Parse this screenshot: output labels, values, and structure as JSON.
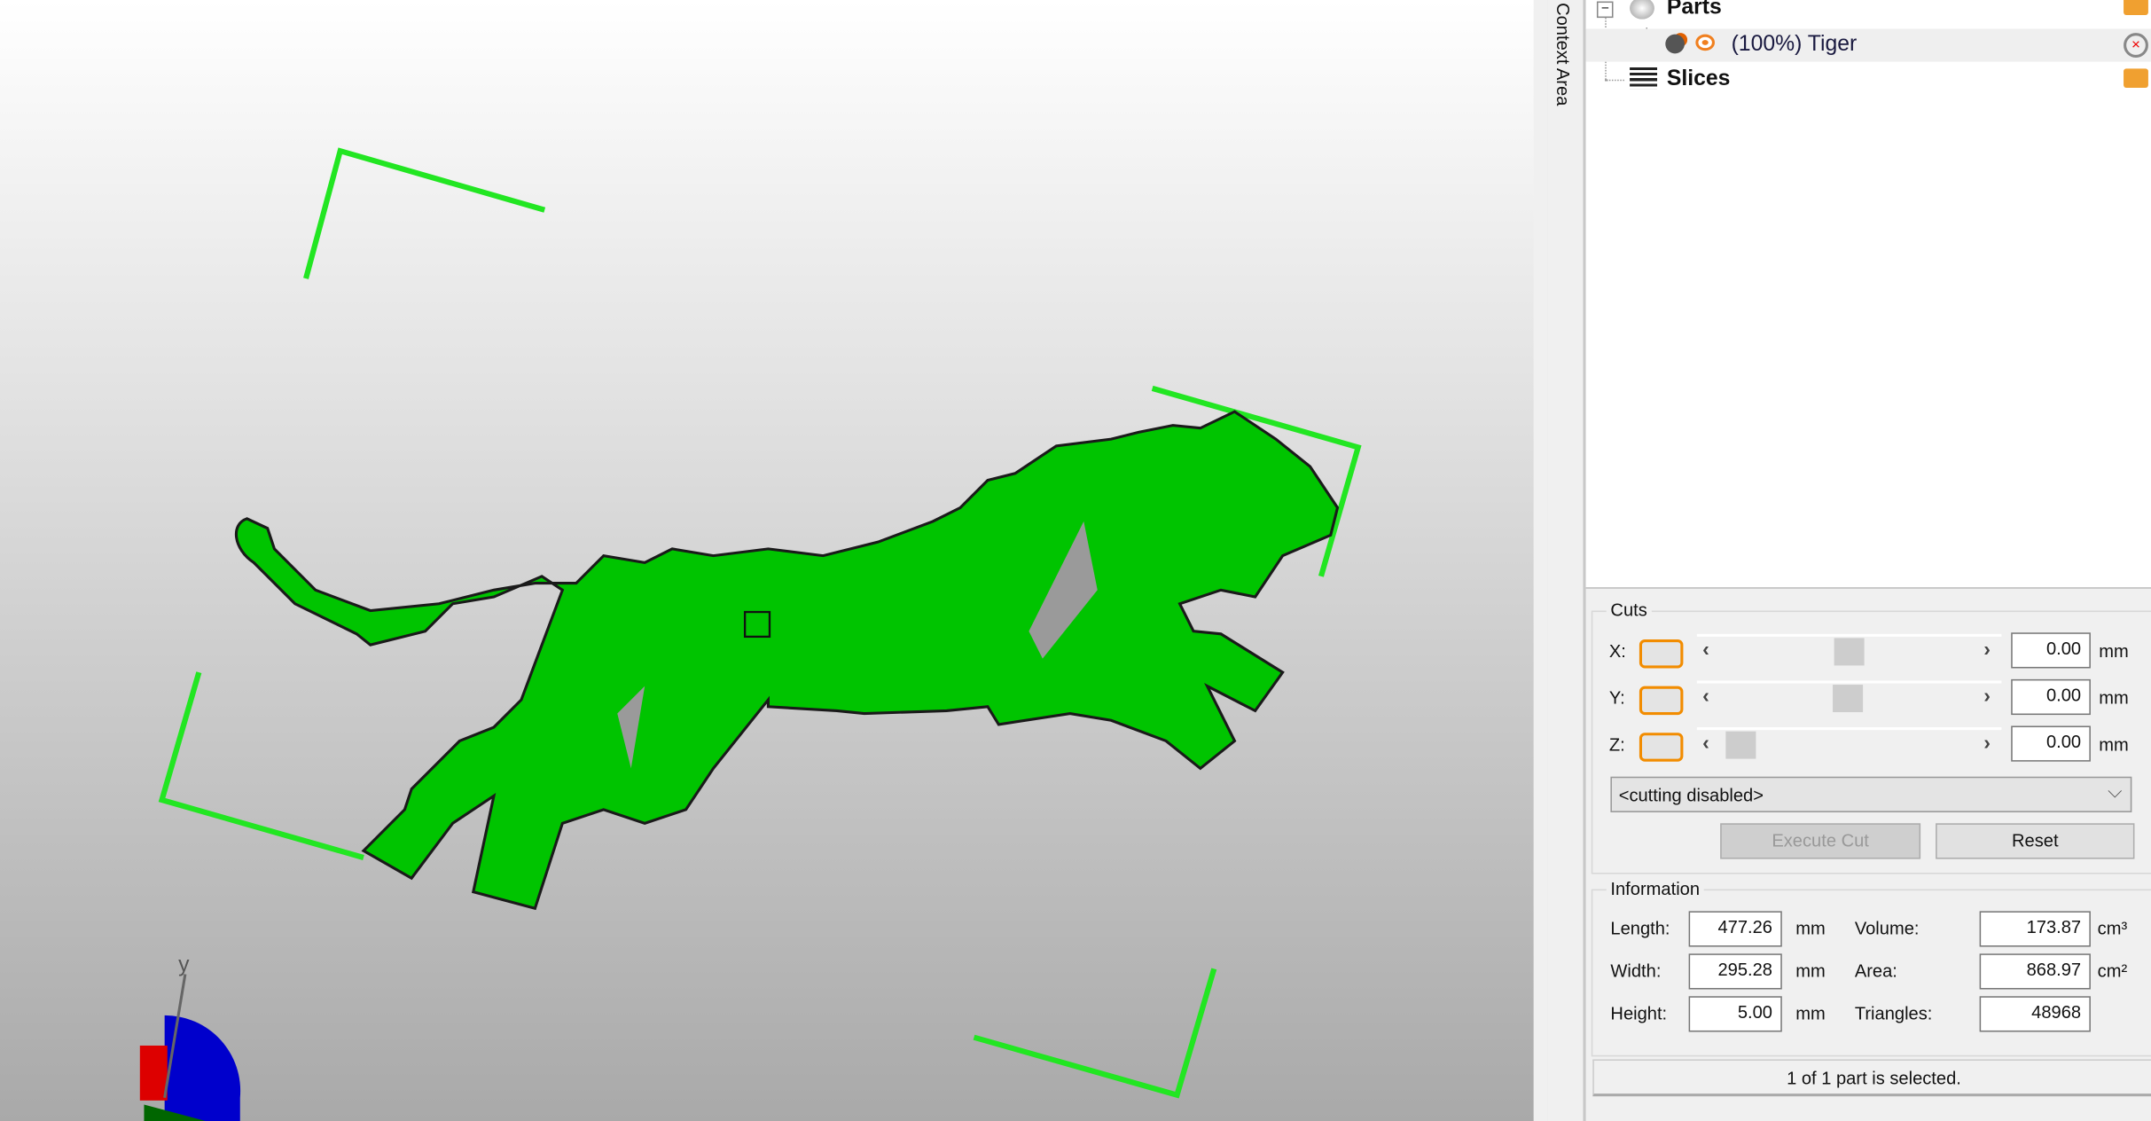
{
  "viewport": {
    "accent_color": "#00c800",
    "bracket_color": "#22e622",
    "axis_label_y": "y"
  },
  "context_area": {
    "label": "Context Area"
  },
  "tree": {
    "parts_label": "Parts",
    "part_item": "(100%) Tiger",
    "slices_label": "Slices"
  },
  "cuts": {
    "title": "Cuts",
    "axes": [
      {
        "label": "X:",
        "value": "0.00",
        "unit": "mm",
        "slider_position": 0.5
      },
      {
        "label": "Y:",
        "value": "0.00",
        "unit": "mm",
        "slider_position": 0.5
      },
      {
        "label": "Z:",
        "value": "0.00",
        "unit": "mm",
        "slider_position": 0.0
      }
    ],
    "mode_select": "<cutting disabled>",
    "execute_label": "Execute Cut",
    "reset_label": "Reset"
  },
  "information": {
    "title": "Information",
    "length_label": "Length:",
    "length": "477.26",
    "length_unit": "mm",
    "width_label": "Width:",
    "width": "295.28",
    "width_unit": "mm",
    "height_label": "Height:",
    "height": "5.00",
    "height_unit": "mm",
    "volume_label": "Volume:",
    "volume": "173.87",
    "volume_unit": "cm³",
    "area_label": "Area:",
    "area": "868.97",
    "area_unit": "cm²",
    "triangles_label": "Triangles:",
    "triangles": "48968"
  },
  "status": "1 of 1 part is selected."
}
